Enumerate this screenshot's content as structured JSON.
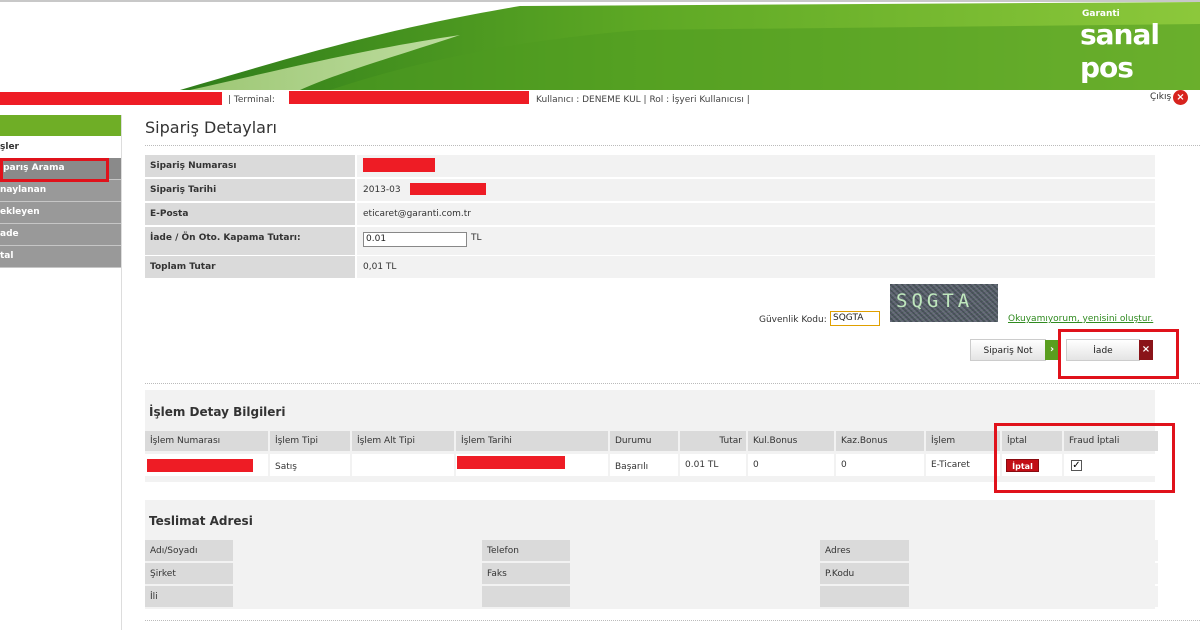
{
  "header": {
    "brand_small": "Garanti",
    "brand_big": "sanal pos",
    "terminal_label": "| Terminal:",
    "user_label": "Kullanıcı : DENEME KUL | Rol : İşyeri Kullanıcısı |",
    "logout_label": "Çıkış",
    "colors": {
      "brand_green": "#6fae26",
      "redaction": "#ee1c25"
    }
  },
  "sidebar": {
    "title": "şler",
    "items": [
      {
        "label": "iparış Arama"
      },
      {
        "label": "naylanan"
      },
      {
        "label": "ekleyen"
      },
      {
        "label": "ade"
      },
      {
        "label": "tal"
      }
    ]
  },
  "page": {
    "title": "Sipariş Detayları"
  },
  "order": {
    "rows": [
      {
        "label": "Sipariş Numarası",
        "value": ""
      },
      {
        "label": "Sipariş Tarihi",
        "value": "2013-03"
      },
      {
        "label": "E-Posta",
        "value": "eticaret@garanti.com.tr"
      },
      {
        "label": "İade / Ön Oto. Kapama Tutarı:",
        "value": "0.01",
        "unit": "TL"
      },
      {
        "label": "Toplam Tutar",
        "value": "0,01 TL"
      }
    ]
  },
  "security": {
    "label": "Güvenlik Kodu:",
    "input_value": "SQGTA",
    "captcha_text": "SQGTA",
    "refresh_link": "Okuyamıyorum, yenisini oluştur."
  },
  "buttons": {
    "note_label": "Sipariş Not",
    "refund_label": "İade"
  },
  "transactions": {
    "title": "İşlem Detay Bilgileri",
    "headers": [
      "İşlem Numarası",
      "İşlem Tipi",
      "İşlem Alt Tipi",
      "İşlem Tarihi",
      "Durumu",
      "Tutar",
      "Kul.Bonus",
      "Kaz.Bonus",
      "İşlem",
      "İptal",
      "Fraud İptali"
    ],
    "row": {
      "type": "Satış",
      "sub_type": "",
      "status": "Başarılı",
      "amount": "0.01 TL",
      "kul_bonus": "0",
      "kaz_bonus": "0",
      "channel": "E-Ticaret",
      "cancel_label": "İptal",
      "fraud_checked": true
    }
  },
  "delivery": {
    "title": "Teslimat Adresi",
    "fields": {
      "name": "Adı/Soyadı",
      "phone": "Telefon",
      "address": "Adres",
      "company": "Şirket",
      "fax": "Faks",
      "postal": "P.Kodu",
      "city": "İli"
    }
  }
}
